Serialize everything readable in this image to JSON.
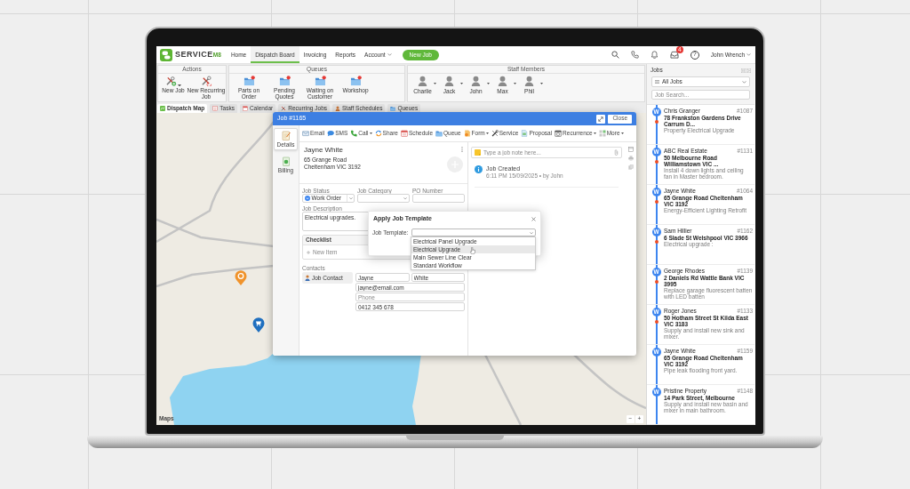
{
  "top_nav": {
    "logo": {
      "word": "SERVICE",
      "mark": "M8"
    },
    "items": [
      {
        "label": "Home",
        "selected": false,
        "kind": "link"
      },
      {
        "label": "Dispatch Board",
        "selected": true,
        "kind": "link"
      },
      {
        "label": "Invoicing",
        "selected": false,
        "kind": "link"
      },
      {
        "label": "Reports",
        "selected": false,
        "kind": "link"
      },
      {
        "label": "Account",
        "selected": false,
        "kind": "menu"
      }
    ],
    "new_job_button": "New Job",
    "inbox_badge": "4",
    "help_button": "?",
    "user": "John Wrench"
  },
  "toolbar": {
    "groups": [
      {
        "title": "Actions",
        "kind": "actions",
        "items": [
          {
            "label": "New Job",
            "kind": "menu"
          },
          {
            "label": "New Recurring Job",
            "kind": "button"
          }
        ]
      },
      {
        "title": "Queues",
        "kind": "queues",
        "items": [
          {
            "label": "Parts on Order"
          },
          {
            "label": "Pending Quotes"
          },
          {
            "label": "Waiting on Customer"
          },
          {
            "label": "Workshop"
          }
        ]
      },
      {
        "title": "Staff Members",
        "kind": "staff",
        "items": [
          {
            "label": "Charlie"
          },
          {
            "label": "Jack"
          },
          {
            "label": "John"
          },
          {
            "label": "Max"
          },
          {
            "label": "Phil"
          }
        ]
      }
    ]
  },
  "view_tabs": [
    {
      "label": "Dispatch Map",
      "selected": true
    },
    {
      "label": "Tasks",
      "selected": false
    },
    {
      "label": "Calendar",
      "selected": false
    },
    {
      "label": "Recurring Jobs",
      "selected": false
    },
    {
      "label": "Staff Schedules",
      "selected": false
    },
    {
      "label": "Queues",
      "selected": false
    }
  ],
  "map": {
    "attribution": "Maps",
    "zoom_out": "−",
    "zoom_in": "+"
  },
  "job_dialog": {
    "title": "Job #1165",
    "close_button": "Close",
    "side_tabs": [
      {
        "label": "Details",
        "selected": true
      },
      {
        "label": "Billing",
        "selected": false
      }
    ],
    "actions": [
      {
        "label": "Email",
        "kind": "button"
      },
      {
        "label": "SMS",
        "kind": "button"
      },
      {
        "label": "Call",
        "kind": "menu"
      },
      {
        "label": "Share",
        "kind": "button"
      },
      {
        "label": "Schedule",
        "kind": "button"
      },
      {
        "label": "Queue",
        "kind": "button"
      },
      {
        "label": "Form",
        "kind": "menu"
      },
      {
        "label": "Service",
        "kind": "button"
      },
      {
        "label": "Proposal",
        "kind": "button"
      },
      {
        "label": "Recurrence",
        "kind": "menu"
      },
      {
        "label": "More",
        "kind": "menu"
      }
    ],
    "client": {
      "name": "Jayne White",
      "address": [
        "65 Grange Road",
        "Cheltenham VIC 3192"
      ]
    },
    "fields": [
      {
        "label": "Job Status",
        "kind": "status",
        "value": "Work Order"
      },
      {
        "label": "Job Category",
        "kind": "select"
      },
      {
        "label": "PO Number",
        "kind": "input"
      }
    ],
    "description": {
      "label": "Job Description",
      "value": "Electrical upgrades."
    },
    "checklist": {
      "title": "Checklist",
      "add_item": "New Item"
    },
    "contacts": {
      "label": "Contacts",
      "tab": "Job Contact",
      "first_name": "Jayne",
      "last_name": "White",
      "email": "jayne@email.com",
      "phone": {
        "placeholder": "Phone"
      },
      "mobile": "0412 345 678"
    },
    "notes": {
      "placeholder": "Type a job note here...",
      "activity": [
        {
          "title": "Job Created",
          "meta": "6:11 PM 15/09/2025 • by John"
        }
      ]
    }
  },
  "template_modal": {
    "title": "Apply Job Template",
    "field_label": "Job Template:",
    "options": [
      {
        "label": "Electrical Panel Upgrade",
        "hovered": false
      },
      {
        "label": "Electrical Upgrade",
        "hovered": true
      },
      {
        "label": "Main Sewer Line Clear",
        "hovered": false
      },
      {
        "label": "Standard Workflow",
        "hovered": false
      }
    ]
  },
  "jobs_panel": {
    "title": "Jobs",
    "filter": "All Jobs",
    "search_placeholder": "Job Search...",
    "jobs": [
      {
        "badge": "W",
        "name": "Chris Granger",
        "number": "#1087",
        "address": "78 Frankston Gardens Drive Carrum D...",
        "description": "Property Electrical Upgrade",
        "flagged": true
      },
      {
        "badge": "W",
        "name": "ABC Real Estate",
        "number": "#1131",
        "address": "50 Melbourne Road Williamstown VIC ...",
        "description": "Install 4 down lights and ceiling fan in Master bedroom.",
        "flagged": true
      },
      {
        "badge": "W",
        "name": "Jayne White",
        "number": "#1064",
        "address": "65 Grange Road Cheltenham VIC 3192",
        "description": "Energy-Efficient Lighting Retrofit",
        "flagged": true
      },
      {
        "badge": "W",
        "name": "Sam Hillier",
        "number": "#1162",
        "address": "6 Slade St Welshpool VIC 3966",
        "description": "Electrical upgrade :",
        "flagged": true
      },
      {
        "badge": "W",
        "name": "George Rhodes",
        "number": "#1139",
        "address": "2 Daniels Rd Wattle Bank VIC 3995",
        "description": "Replace garage fluorescent batten with LED batten",
        "flagged": true
      },
      {
        "badge": "W",
        "name": "Roger Jones",
        "number": "#1133",
        "address": "50 Hotham Street St Kilda East VIC 3183",
        "description": "Supply and install new sink and mixer.",
        "flagged": true
      },
      {
        "badge": "W",
        "name": "Jayne White",
        "number": "#1159",
        "address": "65 Grange Road Cheltenham VIC 3192",
        "description": "Pipe leak flooding front yard.",
        "flagged": false
      },
      {
        "badge": "W",
        "name": "Pristine Property",
        "number": "#1148",
        "address": "14 Park Street, Melbourne",
        "description": "Supply and install new basin and mixer in main bathroom.",
        "flagged": false
      }
    ]
  }
}
